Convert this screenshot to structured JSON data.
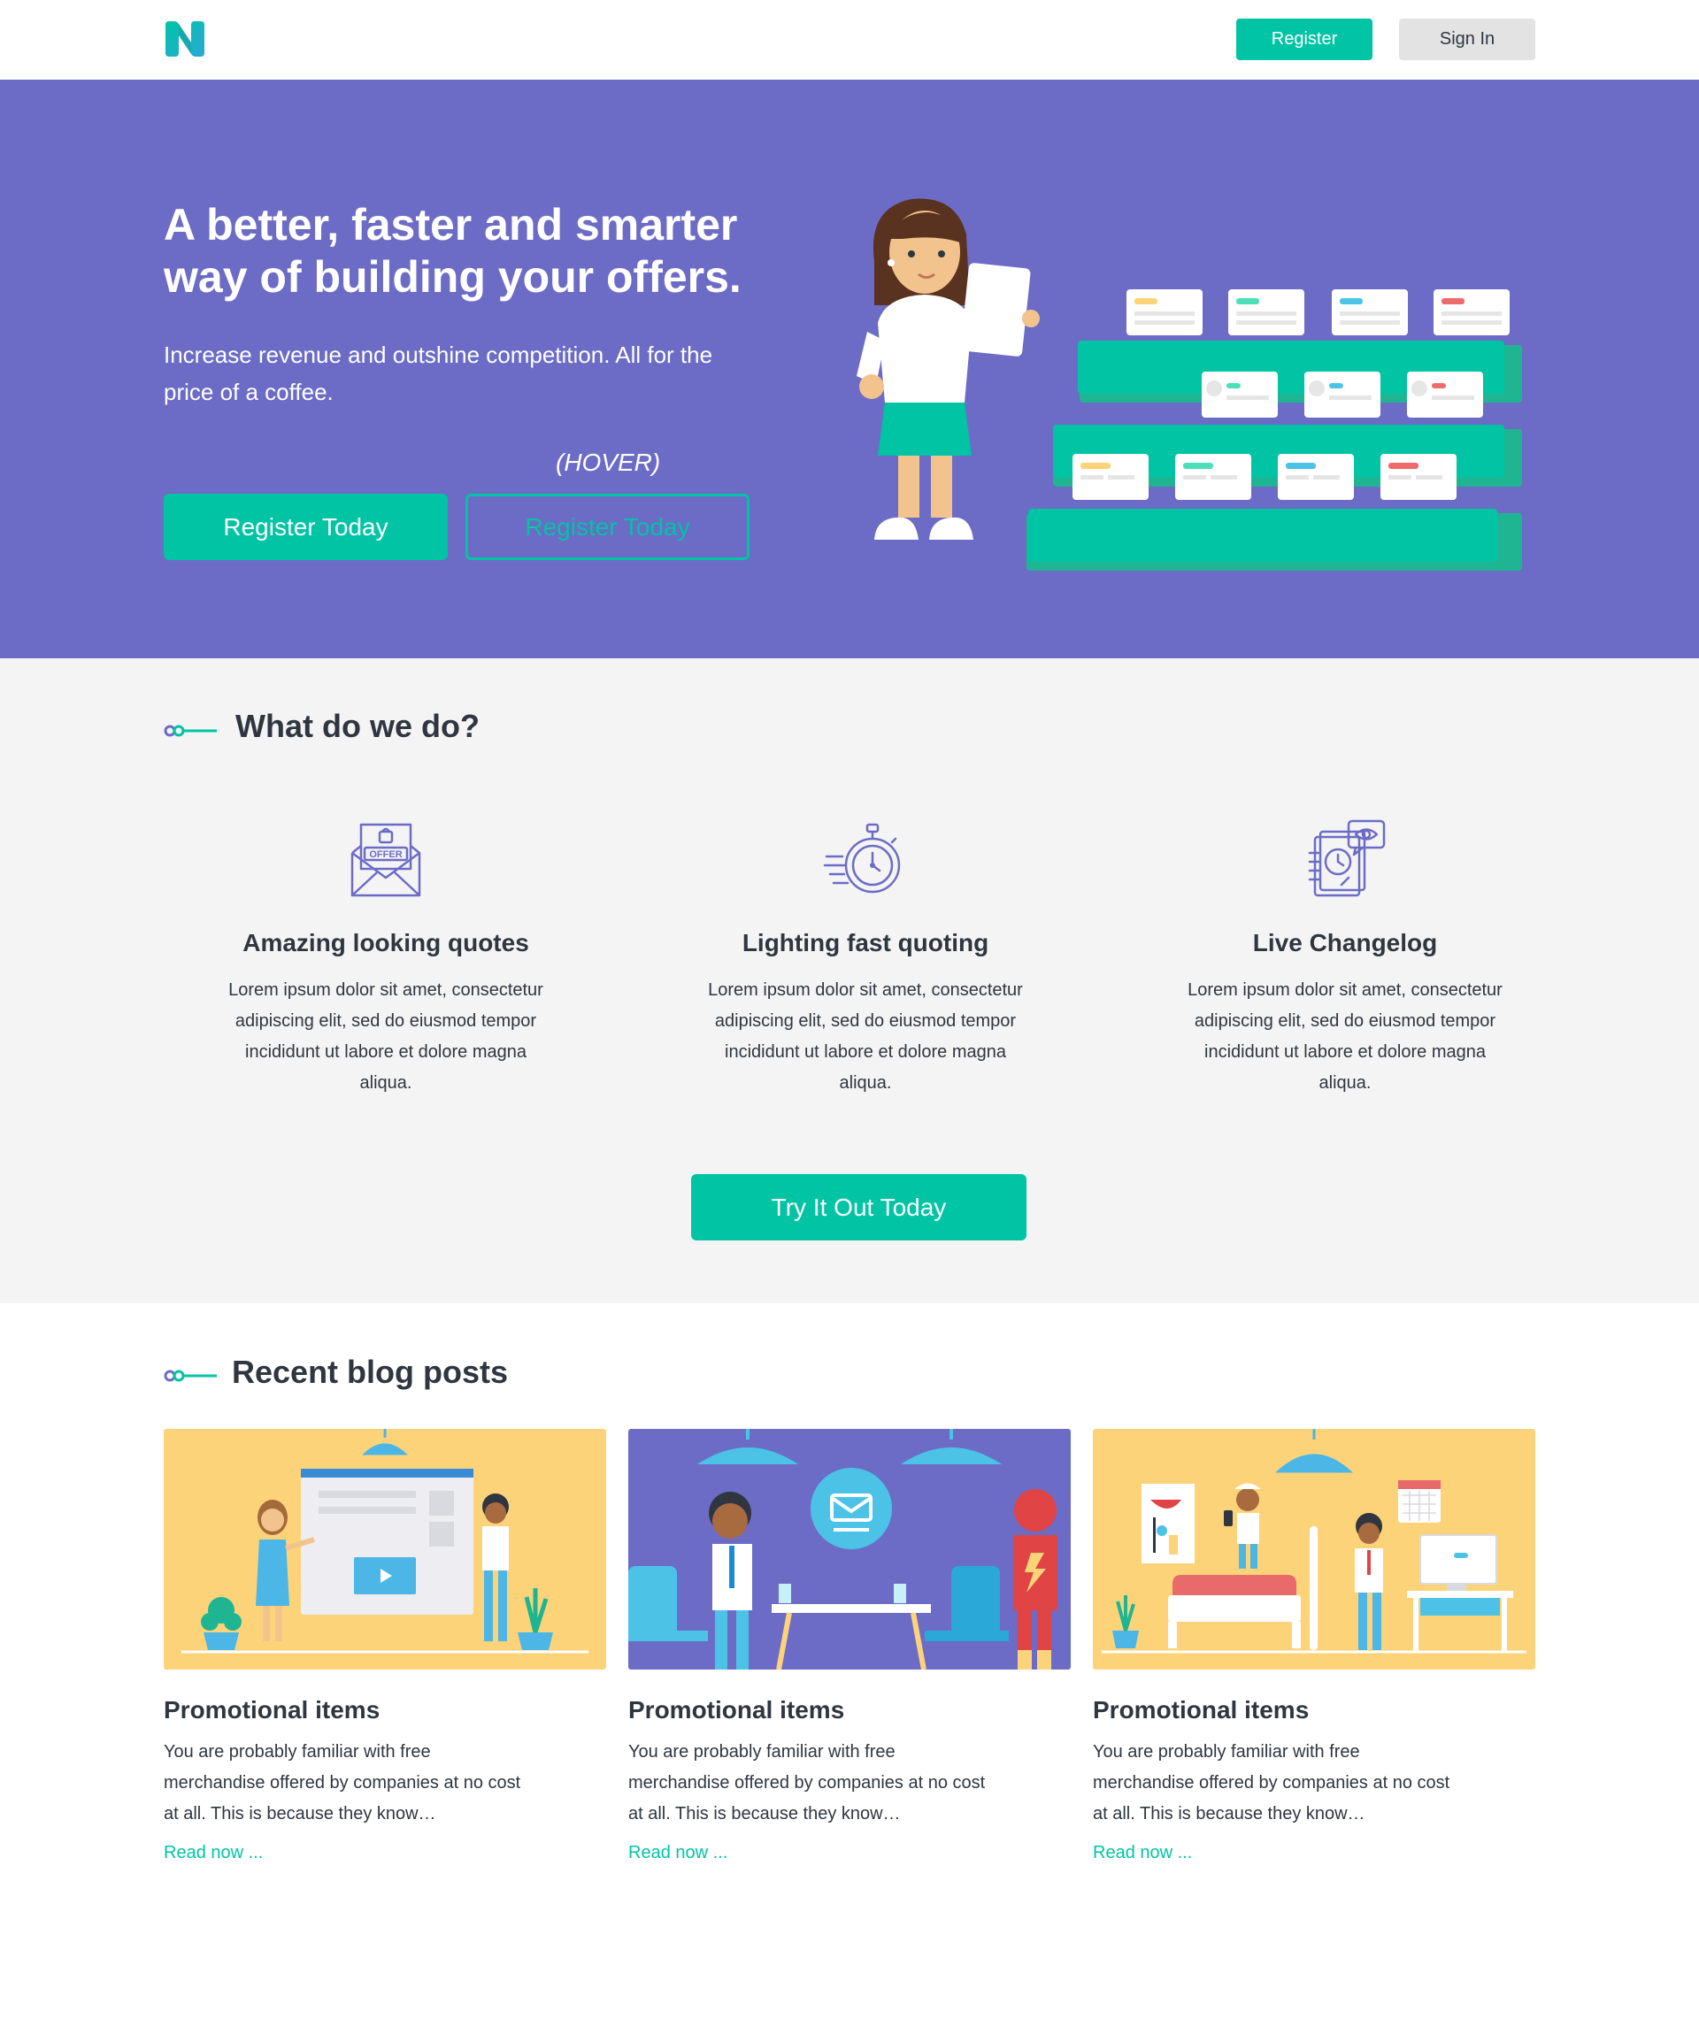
{
  "header": {
    "register_label": "Register",
    "signin_label": "Sign In"
  },
  "hero": {
    "title": "A better, faster and smarter way of building your offers.",
    "subtitle": "Increase revenue and outshine competition. All for the price of a coffee.",
    "hover_label": "(HOVER)",
    "cta_label": "Register Today",
    "cta_hover_label": "Register Today"
  },
  "what": {
    "heading": "What do we do?",
    "features": [
      {
        "icon": "offer-envelope-icon",
        "title": "Amazing looking quotes",
        "text": "Lorem ipsum dolor sit amet, consectetur adipiscing elit, sed do eiusmod tempor incididunt ut labore et dolore magna aliqua."
      },
      {
        "icon": "stopwatch-icon",
        "title": "Lighting fast quoting",
        "text": "Lorem ipsum dolor sit amet, consectetur adipiscing elit, sed do eiusmod tempor incididunt ut labore et dolore magna aliqua."
      },
      {
        "icon": "changelog-eye-icon",
        "title": "Live Changelog",
        "text": "Lorem ipsum dolor sit amet, consectetur adipiscing elit, sed do eiusmod tempor incididunt ut labore et dolore magna aliqua."
      }
    ],
    "cta_label": "Try It Out Today"
  },
  "blog": {
    "heading": "Recent blog posts",
    "posts": [
      {
        "title": "Promotional items",
        "excerpt": "You are probably familiar with free merchandise offered by companies at no cost at all.  This is because they know…",
        "link": "Read now ..."
      },
      {
        "title": "Promotional items",
        "excerpt": "You are probably familiar with free merchandise offered by companies at no cost at all.  This is because they know…",
        "link": "Read now ..."
      },
      {
        "title": "Promotional items",
        "excerpt": "You are probably familiar with free merchandise offered by companies at no cost at all.  This is because they know…",
        "link": "Read now ..."
      }
    ]
  },
  "colors": {
    "accent": "#00c4a4",
    "hero_bg": "#6c6cc6",
    "section_bg": "#f4f4f4",
    "text": "#2f3640",
    "icon": "#6c6cc6",
    "card_yellow": "#fdd37a",
    "card_purple": "#6c6cc6"
  }
}
